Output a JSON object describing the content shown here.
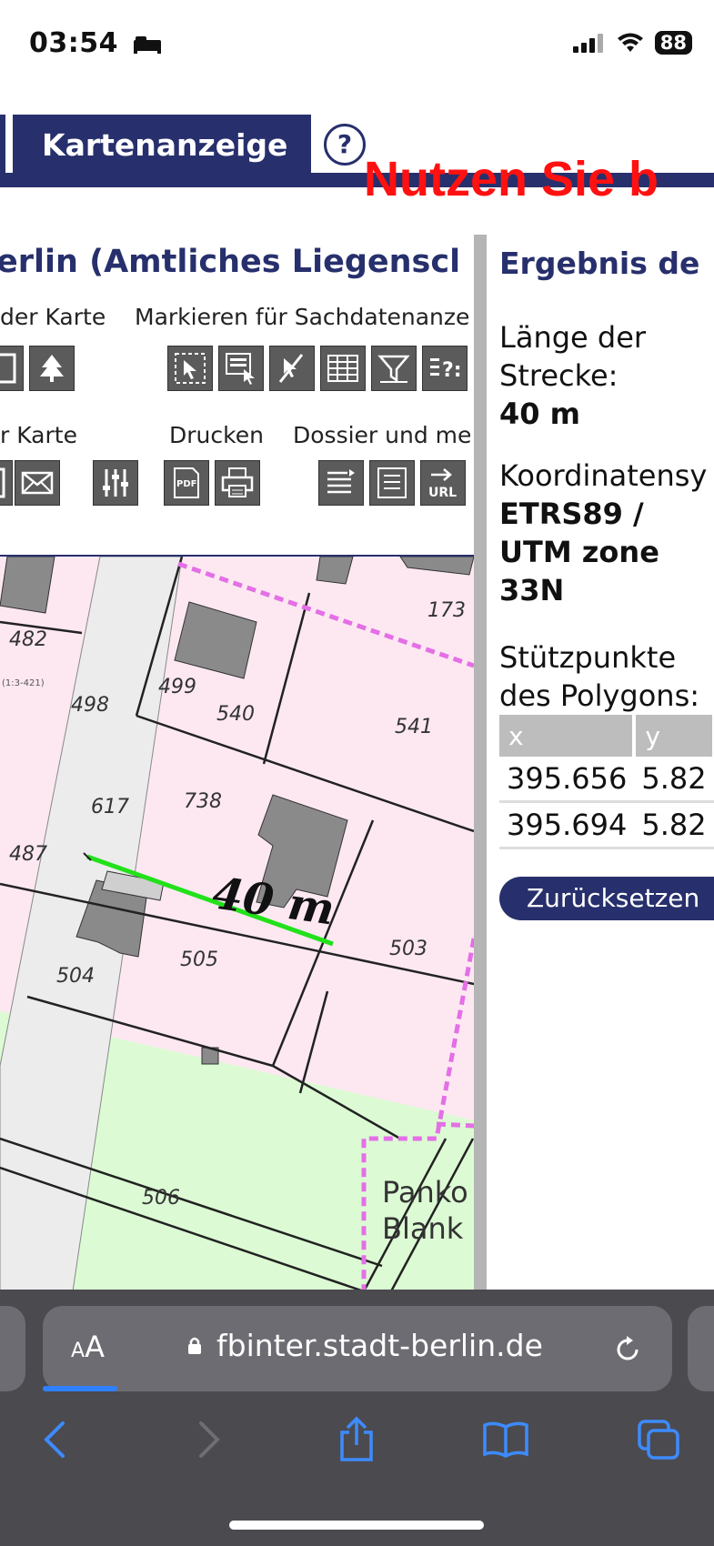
{
  "status_bar": {
    "time": "03:54",
    "battery": "88"
  },
  "header": {
    "tab_title": "Kartenanzeige",
    "help": "?",
    "notice": "Nutzen Sie b"
  },
  "left_panel": {
    "title": "erlin (Amtliches Liegenscl",
    "toolbar_row1": {
      "label_a": "der Karte",
      "label_b": "Markieren für Sachdatenanze"
    },
    "toolbar_row2": {
      "label_a": "r Karte",
      "label_b": "Drucken",
      "label_c": "Dossier und me"
    },
    "tools": {
      "pdf": "PDF",
      "url": "URL"
    }
  },
  "map": {
    "parcels": [
      "482",
      "499",
      "498",
      "540",
      "541",
      "173",
      "617",
      "738",
      "487",
      "505",
      "503",
      "504",
      "506"
    ],
    "small_label": "(1:3-421)",
    "measure_label": "40 m",
    "place_names": [
      "Panko",
      "Blank"
    ]
  },
  "right_panel": {
    "title": "Ergebnis de",
    "length_label_1": "Länge der",
    "length_label_2": "Strecke:",
    "length_value": "40 m",
    "crs_label": "Koordinatensy",
    "crs_value_1": "ETRS89 /",
    "crs_value_2": "UTM zone",
    "crs_value_3": "33N",
    "vertices_label_1": "Stützpunkte",
    "vertices_label_2": "des Polygons:",
    "table": {
      "headers": [
        "x",
        "y"
      ],
      "rows": [
        [
          "395.656",
          "5.82"
        ],
        [
          "395.694",
          "5.82"
        ]
      ]
    },
    "reset_button": "Zurücksetzen"
  },
  "browser": {
    "text_size": "AA",
    "url": "fbinter.stadt-berlin.de"
  },
  "colors": {
    "brand_navy": "#27306c",
    "notice_red": "#ff1111",
    "measure_green": "#22e11a",
    "parcel_pink": "#fde8f2",
    "green_area": "#dcfbd4"
  }
}
